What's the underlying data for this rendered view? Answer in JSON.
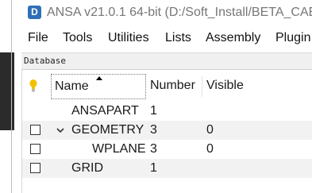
{
  "window": {
    "title": "ANSA v21.0.1 64-bit (D:/Soft_Install/BETA_CAE",
    "logo_letter": "D"
  },
  "menubar": [
    "File",
    "Tools",
    "Utilities",
    "Lists",
    "Assembly",
    "Plugin"
  ],
  "panel": {
    "title": "Database"
  },
  "tree": {
    "columns": {
      "name": "Name",
      "number": "Number",
      "visible": "Visible"
    },
    "sort": {
      "column": "Name",
      "direction": "ascending"
    },
    "header_icon": "lightbulb-icon",
    "rows": [
      {
        "name": "ANSAPART",
        "number": "1",
        "visible": "",
        "checkbox": false,
        "expander": "none"
      },
      {
        "name": "GEOMETRY",
        "number": "3",
        "visible": "0",
        "checkbox": true,
        "expander": "expanded"
      },
      {
        "name": "WPLANE",
        "number": "3",
        "visible": "0",
        "checkbox": true,
        "expander": "none"
      },
      {
        "name": "GRID",
        "number": "1",
        "visible": "",
        "checkbox": true,
        "expander": "none"
      }
    ]
  },
  "colors": {
    "logo": "#2f6fb7",
    "stripe": "#f2f2f2",
    "lightbulb": "#f2c100"
  }
}
